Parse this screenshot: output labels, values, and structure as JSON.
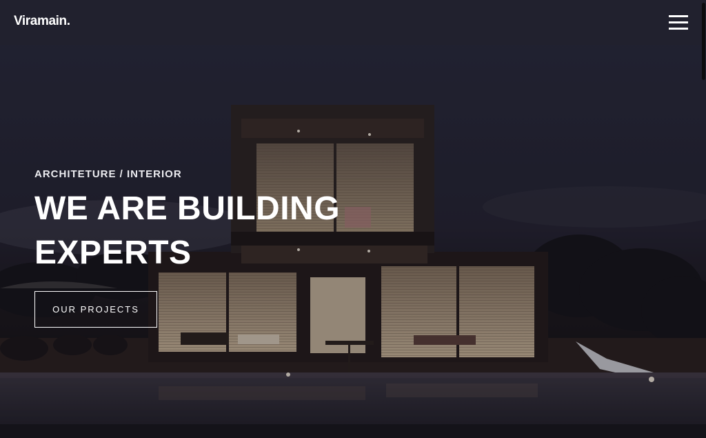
{
  "brand": {
    "logo_text": "Viramain."
  },
  "nav": {
    "menu_icon": "hamburger-menu-icon"
  },
  "hero": {
    "eyebrow": "ARCHITETURE / INTERIOR",
    "headline_lines": [
      "WE ARE BUILDING",
      "EXPERTS"
    ],
    "cta_label": "OUR PROJECTS",
    "background": "modern-house-at-night-photo"
  },
  "colors": {
    "navbar_bg": "#21212e",
    "text": "#ffffff",
    "sky": "#262635"
  }
}
